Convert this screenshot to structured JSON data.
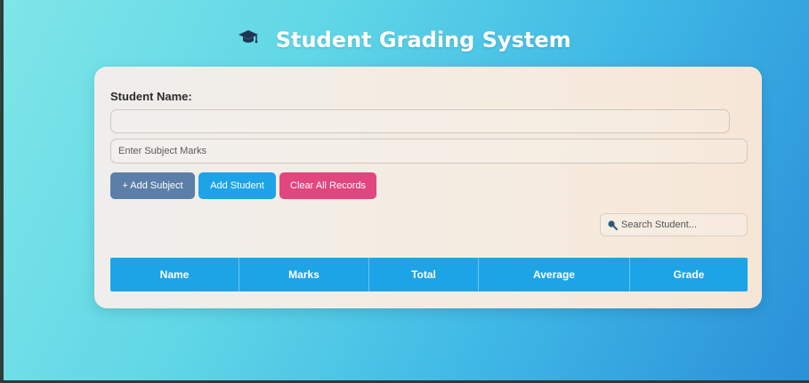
{
  "app": {
    "title": "Student Grading System",
    "icon": "graduation-cap-icon"
  },
  "form": {
    "student_name_label": "Student Name:",
    "student_name_value": "",
    "subject_marks_placeholder": "Enter Subject Marks",
    "subject_marks_value": ""
  },
  "buttons": {
    "add_subject": "+ Add Subject",
    "add_student": "Add Student",
    "clear_all": "Clear All Records"
  },
  "search": {
    "icon": "search-icon",
    "placeholder": "Search Student..."
  },
  "table": {
    "columns": [
      "Name",
      "Marks",
      "Total",
      "Average",
      "Grade"
    ],
    "rows": []
  },
  "colors": {
    "accent_blue": "#1da4e6",
    "add_subject_button": "#5b7fa8",
    "clear_button": "#e1467e"
  }
}
